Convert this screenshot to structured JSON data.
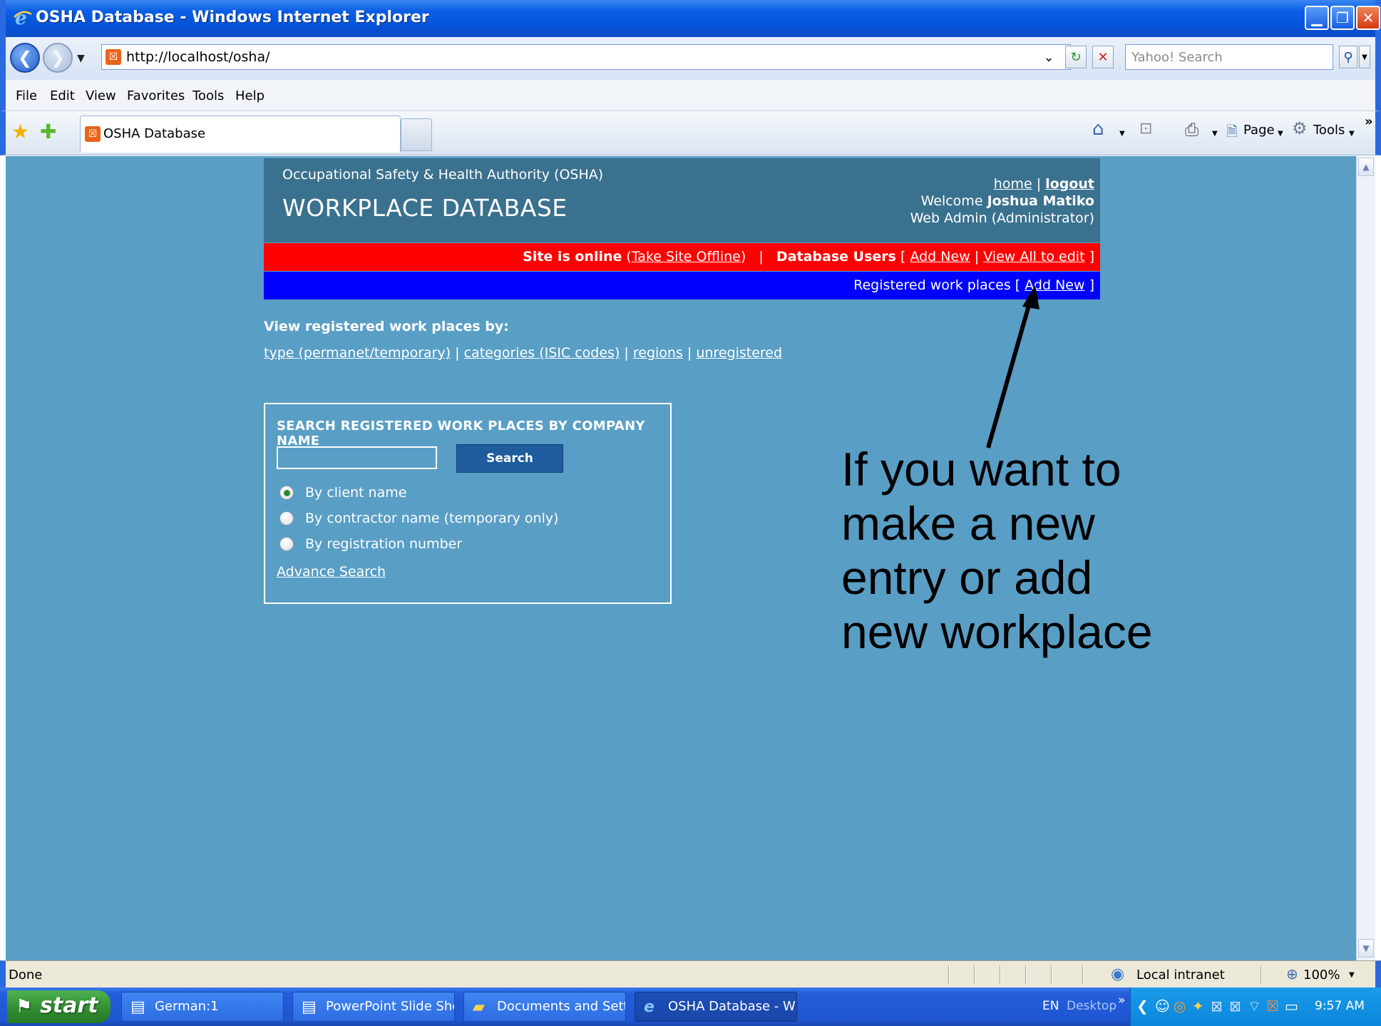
{
  "window": {
    "title": "OSHA Database - Windows Internet Explorer"
  },
  "address_bar": {
    "url": "http://localhost/osha/",
    "search_placeholder": "Yahoo! Search"
  },
  "menu": [
    "File",
    "Edit",
    "View",
    "Favorites",
    "Tools",
    "Help"
  ],
  "tab": {
    "label": "OSHA Database"
  },
  "command_bar": {
    "page_label": "Page",
    "tools_label": "Tools"
  },
  "header": {
    "org_name": "Occupational Safety & Health Authority (OSHA)",
    "site_title": "WORKPLACE DATABASE",
    "home_link": "home",
    "separator": "|",
    "logout_link": "logout",
    "welcome_prefix": "Welcome",
    "user_name": "Joshua Matiko",
    "role": "Web Admin (Administrator)"
  },
  "red_bar": {
    "site_status": "Site is online",
    "take_offline_link": "Take Site Offline",
    "db_users_label": "Database Users",
    "add_new_link": "Add New",
    "view_all_link": "View All to edit"
  },
  "blue_bar": {
    "label": "Registered work places",
    "add_new_link": "Add New"
  },
  "view_by": {
    "heading": "View registered work places by:",
    "links": [
      "type (permanet/temporary)",
      "categories (ISIC codes)",
      "regions",
      "unregistered"
    ]
  },
  "search_panel": {
    "heading": "SEARCH REGISTERED WORK PLACES BY COMPANY NAME",
    "input_value": "",
    "search_button": "Search",
    "options": [
      {
        "label": "By client name",
        "checked": true
      },
      {
        "label": "By contractor name (temporary only)",
        "checked": false
      },
      {
        "label": "By registration number",
        "checked": false
      }
    ],
    "advance_link": "Advance Search"
  },
  "annotation": {
    "lines": [
      "If you want to",
      "make a new",
      "entry or add",
      "new workplace"
    ]
  },
  "status_bar": {
    "status": "Done",
    "zone": "Local intranet",
    "zoom": "100%"
  },
  "taskbar": {
    "start_label": "start",
    "buttons": [
      {
        "label": "German:1",
        "active": false
      },
      {
        "label": "PowerPoint Slide Sho...",
        "active": false
      },
      {
        "label": "Documents and Settings",
        "active": false
      },
      {
        "label": "OSHA Database - Wi...",
        "active": true
      }
    ],
    "tray": {
      "language": "EN",
      "desktop_label": "Desktop",
      "clock": "9:57 AM"
    }
  },
  "colors": {
    "page_background": "#599ec5",
    "header_background": "#3a718e",
    "red_bar": "#ff0000",
    "blue_bar": "#0000ff",
    "search_button": "#1f5c9e"
  }
}
